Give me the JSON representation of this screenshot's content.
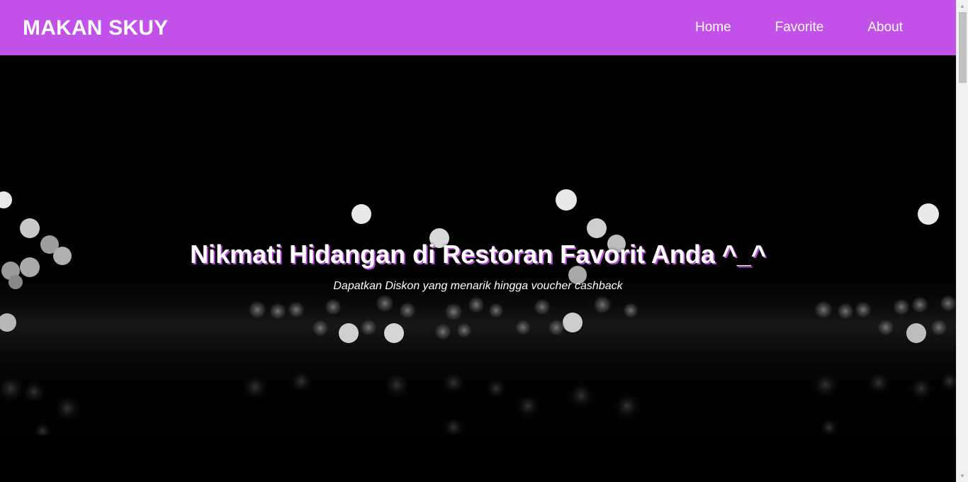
{
  "app_bar": {
    "brand": "MAKAN SKUY",
    "background_color": "#c151e9",
    "nav_items": [
      {
        "label": "Home"
      },
      {
        "label": "Favorite"
      },
      {
        "label": "About"
      }
    ]
  },
  "hero": {
    "title": "Nikmati Hidangan di Restoran Favorit Anda ^_^",
    "subtitle": "Dapatkan Diskon yang menarik hingga voucher cashback",
    "background": "bokeh-lights-image"
  }
}
